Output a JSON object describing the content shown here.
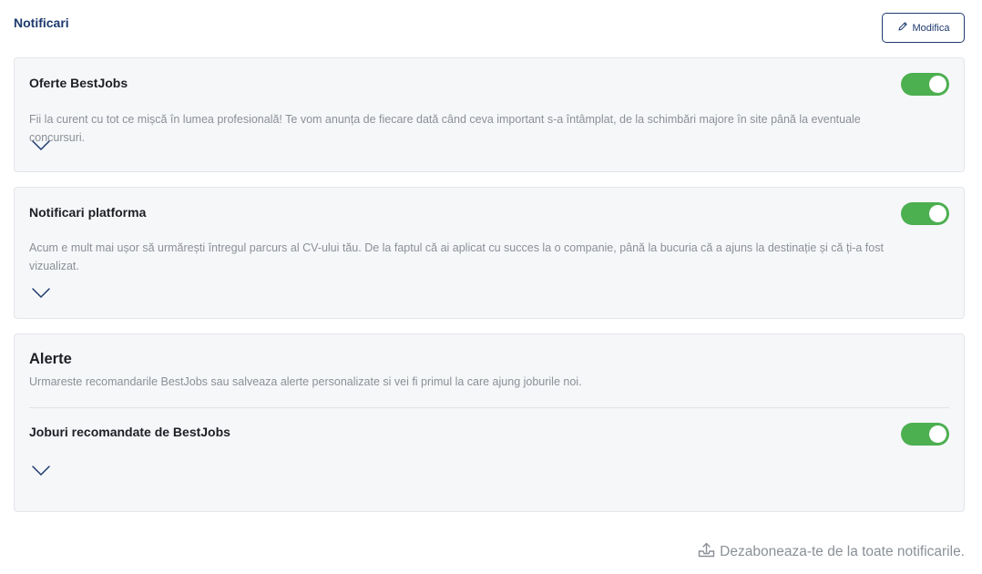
{
  "header": {
    "title": "Notificari",
    "edit_label": "Modifica"
  },
  "sections": {
    "offers": {
      "title": "Oferte BestJobs",
      "description": "Fii la curent cu tot ce mișcă în lumea profesională! Te vom anunța de fiecare dată când ceva important s-a întâmplat, de la schimbări majore în site până la eventuale concursuri.",
      "enabled": true
    },
    "platform": {
      "title": "Notificari platforma",
      "description": "Acum e mult mai ușor să urmărești întregul parcurs al CV-ului tău. De la faptul că ai aplicat cu succes la o companie, până la bucuria că a ajuns la destinație și că ți-a fost vizualizat.",
      "enabled": true
    },
    "alerts": {
      "heading": "Alerte",
      "description": "Urmareste recomandarile BestJobs sau salveaza alerte personalizate si vei fi primul la care ajung joburile noi.",
      "recommended": {
        "title": "Joburi recomandate de BestJobs",
        "enabled": true
      }
    }
  },
  "footer": {
    "unsubscribe_label": "Dezaboneaza-te de la toate notificarile."
  },
  "colors": {
    "accent": "#1e3a6e",
    "toggle_on": "#4caf50",
    "card_bg": "#f6f7f9",
    "muted_text": "#8a9097"
  },
  "icons": {
    "edit": "pencil-icon",
    "expand": "chevron-down-icon",
    "unsubscribe": "tray-upload-icon"
  }
}
